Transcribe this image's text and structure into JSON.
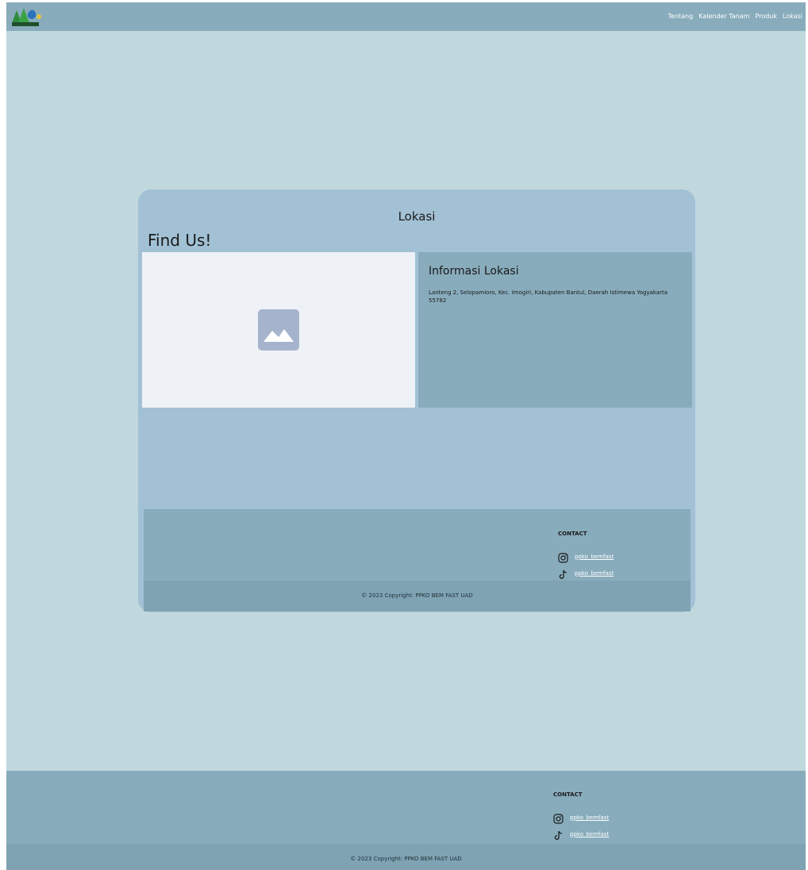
{
  "header": {
    "logo_name": "ppko-logo",
    "nav": [
      {
        "label": "Tentang"
      },
      {
        "label": "Kalender Tanam"
      },
      {
        "label": "Produk"
      },
      {
        "label": "Lokasi"
      }
    ]
  },
  "main": {
    "section_title": "Lokasi",
    "heading": "Find Us!",
    "map_icon": "image-placeholder-icon",
    "info": {
      "title": "Informasi Lokasi",
      "address": "Lanteng 2, Selopamioro, Kec. Imogiri, Kabupaten Bantul, Daerah Istimewa Yogyakarta 55782"
    },
    "footer": {
      "contact_heading": "CONTACT",
      "instagram": "ppko_bemfast",
      "tiktok": "ppko_bemfast",
      "copyright": "© 2023 Copyright: PPKO BEM FAST UAD"
    }
  },
  "page_footer": {
    "contact_heading": "CONTACT",
    "instagram": "ppko_bemfast",
    "tiktok": "ppko_bemfast",
    "copyright": "© 2023 Copyright: PPKO BEM FAST UAD"
  },
  "colors": {
    "background": "#c0d7de",
    "header": "#88acbc",
    "card": "#a2c1d5",
    "copyright_bar": "#7fa3b3"
  }
}
